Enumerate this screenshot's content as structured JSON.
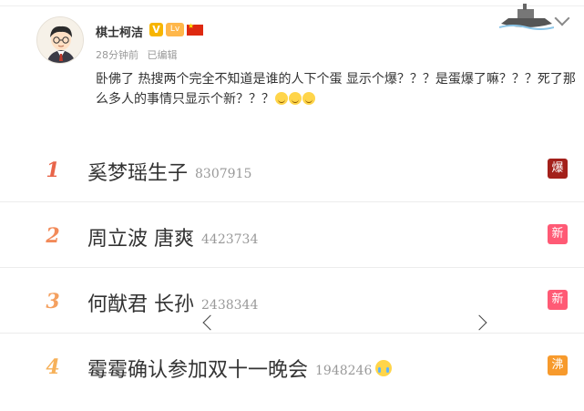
{
  "post": {
    "username": "棋士柯洁",
    "verified_badge": "V",
    "level_badge": "Lv",
    "time": "28分钟前",
    "edited": "已编辑",
    "text": "卧佛了 热搜两个完全不知道是谁的人下个蛋 显示个爆？？？是蛋爆了嘛？？？死了那么多人的事情只显示个新？？？",
    "emoji_count": 3
  },
  "hot_list": [
    {
      "rank": "1",
      "topic": "奚梦瑶生子",
      "count": "8307915",
      "tag": "爆",
      "tag_color": "#a3201a",
      "rank_color": "#e8654a"
    },
    {
      "rank": "2",
      "topic": "周立波 唐爽",
      "count": "4423734",
      "tag": "新",
      "tag_color": "#ff5a75",
      "rank_color": "#f28a59"
    },
    {
      "rank": "3",
      "topic": "何猷君 长孙",
      "count": "2438344",
      "tag": "新",
      "tag_color": "#ff5a75",
      "rank_color": "#f4a05f"
    },
    {
      "rank": "4",
      "topic": "霉霉确认参加双十一晚会",
      "count": "1948246",
      "tag": "沸",
      "tag_color": "#f79a2c",
      "rank_color": "#f6b15a"
    }
  ],
  "colors": {
    "hot_tag": "#a3201a",
    "new_tag": "#ff5a75",
    "boil_tag": "#f79a2c"
  }
}
